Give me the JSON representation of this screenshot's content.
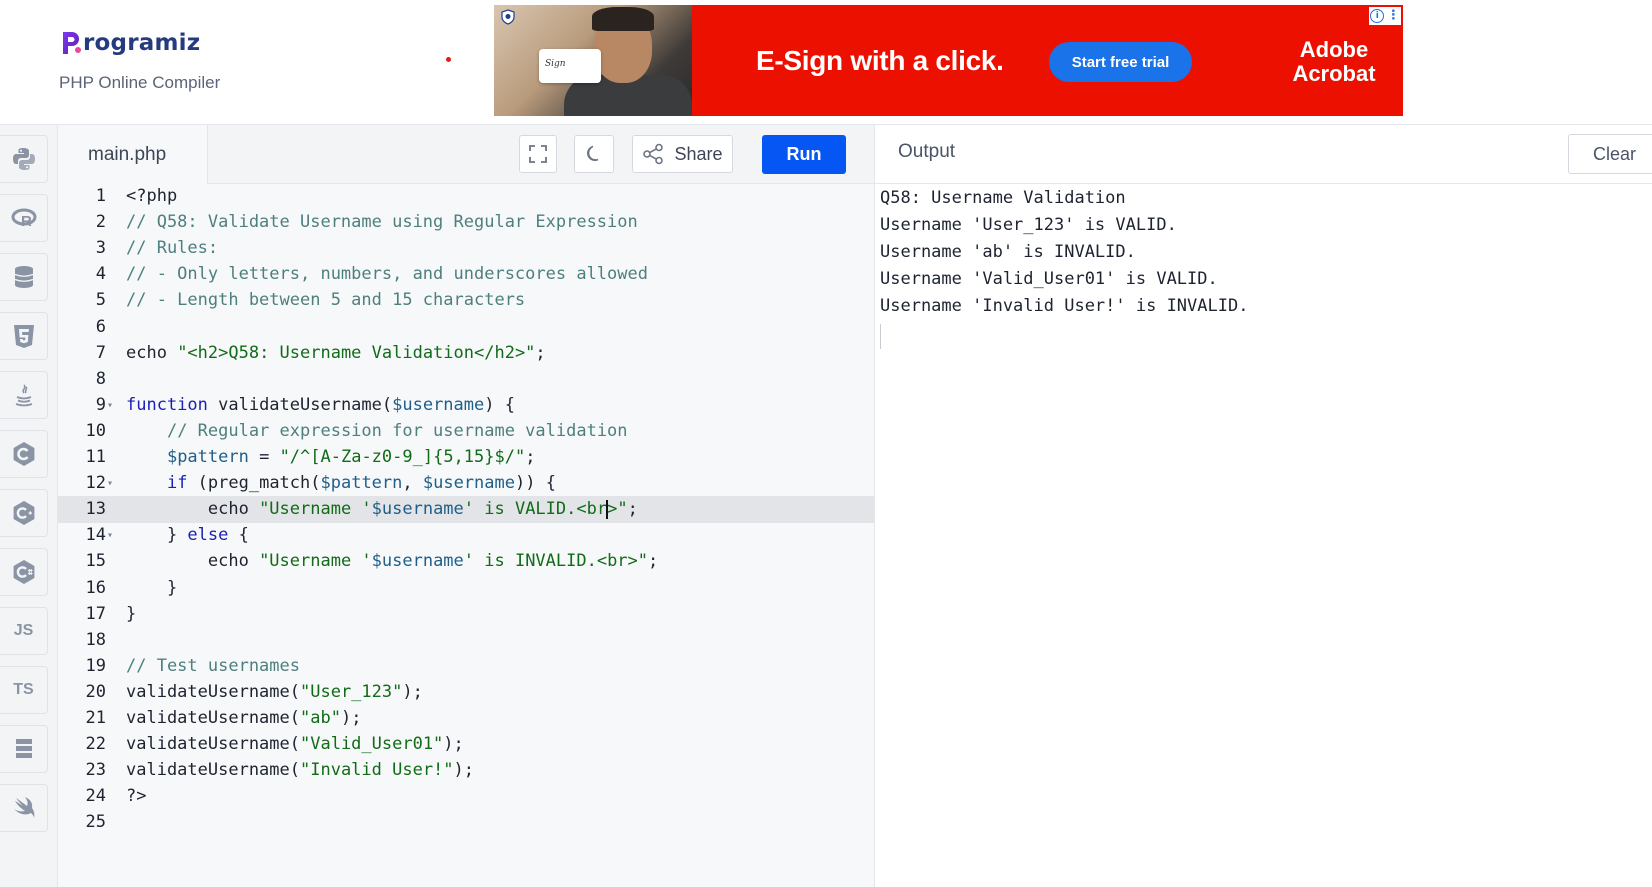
{
  "header": {
    "brand": "rogramiz",
    "subtitle": "PHP Online Compiler"
  },
  "ad": {
    "headline": "E-Sign with a click.",
    "cta": "Start free trial",
    "brand_line1": "Adobe",
    "brand_line2": "Acrobat",
    "card_text": "Sign"
  },
  "rail": {
    "items": [
      {
        "icon": "python-icon"
      },
      {
        "icon": "r-icon"
      },
      {
        "icon": "sql-icon"
      },
      {
        "icon": "html5-icon"
      },
      {
        "icon": "java-icon"
      },
      {
        "icon": "c-icon"
      },
      {
        "icon": "cpp-icon"
      },
      {
        "icon": "csharp-icon"
      },
      {
        "icon": "js-icon",
        "label": "JS"
      },
      {
        "icon": "ts-icon",
        "label": "TS"
      },
      {
        "icon": "go-icon"
      },
      {
        "icon": "swift-icon"
      }
    ]
  },
  "editor": {
    "file_name": "main.php",
    "share_label": "Share",
    "run_label": "Run",
    "active_line": 13,
    "lines": [
      {
        "n": "1",
        "fold": "",
        "tokens": [
          [
            "plain",
            "<?php"
          ]
        ]
      },
      {
        "n": "2",
        "fold": "",
        "tokens": [
          [
            "comment",
            "// Q58: Validate Username using Regular Expression"
          ]
        ]
      },
      {
        "n": "3",
        "fold": "",
        "tokens": [
          [
            "comment",
            "// Rules:"
          ]
        ]
      },
      {
        "n": "4",
        "fold": "",
        "tokens": [
          [
            "comment",
            "// - Only letters, numbers, and underscores allowed"
          ]
        ]
      },
      {
        "n": "5",
        "fold": "",
        "tokens": [
          [
            "comment",
            "// - Length between 5 and 15 characters"
          ]
        ]
      },
      {
        "n": "6",
        "fold": "",
        "tokens": []
      },
      {
        "n": "7",
        "fold": "",
        "tokens": [
          [
            "plain",
            "echo "
          ],
          [
            "string",
            "\"<h2>Q58: Username Validation</h2>\""
          ],
          [
            "plain",
            ";"
          ]
        ]
      },
      {
        "n": "8",
        "fold": "",
        "tokens": []
      },
      {
        "n": "9",
        "fold": "▾",
        "tokens": [
          [
            "kw",
            "function"
          ],
          [
            "plain",
            " validateUsername("
          ],
          [
            "var",
            "$username"
          ],
          [
            "plain",
            ") {"
          ]
        ]
      },
      {
        "n": "10",
        "fold": "",
        "tokens": [
          [
            "plain",
            "    "
          ],
          [
            "comment",
            "// Regular expression for username validation"
          ]
        ]
      },
      {
        "n": "11",
        "fold": "",
        "tokens": [
          [
            "plain",
            "    "
          ],
          [
            "var",
            "$pattern"
          ],
          [
            "plain",
            " = "
          ],
          [
            "string",
            "\"/^[A-Za-z0-9_]{5,15}$/\""
          ],
          [
            "plain",
            ";"
          ]
        ]
      },
      {
        "n": "12",
        "fold": "▾",
        "tokens": [
          [
            "plain",
            "    "
          ],
          [
            "kw",
            "if"
          ],
          [
            "plain",
            " (preg_match("
          ],
          [
            "var",
            "$pattern"
          ],
          [
            "plain",
            ", "
          ],
          [
            "var",
            "$username"
          ],
          [
            "plain",
            ")) {"
          ]
        ]
      },
      {
        "n": "13",
        "fold": "",
        "tokens": [
          [
            "plain",
            "        echo "
          ],
          [
            "string",
            "\"Username '"
          ],
          [
            "var",
            "$username"
          ],
          [
            "string",
            "' is VALID.<br"
          ],
          [
            "cursor",
            ""
          ],
          [
            "string",
            ">\""
          ],
          [
            "plain",
            ";"
          ]
        ]
      },
      {
        "n": "14",
        "fold": "▾",
        "tokens": [
          [
            "plain",
            "    } "
          ],
          [
            "kw",
            "else"
          ],
          [
            "plain",
            " {"
          ]
        ]
      },
      {
        "n": "15",
        "fold": "",
        "tokens": [
          [
            "plain",
            "        echo "
          ],
          [
            "string",
            "\"Username '"
          ],
          [
            "var",
            "$username"
          ],
          [
            "string",
            "' is INVALID.<br>\""
          ],
          [
            "plain",
            ";"
          ]
        ]
      },
      {
        "n": "16",
        "fold": "",
        "tokens": [
          [
            "plain",
            "    }"
          ]
        ]
      },
      {
        "n": "17",
        "fold": "",
        "tokens": [
          [
            "plain",
            "}"
          ]
        ]
      },
      {
        "n": "18",
        "fold": "",
        "tokens": []
      },
      {
        "n": "19",
        "fold": "",
        "tokens": [
          [
            "comment",
            "// Test usernames"
          ]
        ]
      },
      {
        "n": "20",
        "fold": "",
        "tokens": [
          [
            "plain",
            "validateUsername("
          ],
          [
            "string",
            "\"User_123\""
          ],
          [
            "plain",
            ");"
          ]
        ]
      },
      {
        "n": "21",
        "fold": "",
        "tokens": [
          [
            "plain",
            "validateUsername("
          ],
          [
            "string",
            "\"ab\""
          ],
          [
            "plain",
            ");"
          ]
        ]
      },
      {
        "n": "22",
        "fold": "",
        "tokens": [
          [
            "plain",
            "validateUsername("
          ],
          [
            "string",
            "\"Valid_User01\""
          ],
          [
            "plain",
            ");"
          ]
        ]
      },
      {
        "n": "23",
        "fold": "",
        "tokens": [
          [
            "plain",
            "validateUsername("
          ],
          [
            "string",
            "\"Invalid User!\""
          ],
          [
            "plain",
            ");"
          ]
        ]
      },
      {
        "n": "24",
        "fold": "",
        "tokens": [
          [
            "plain",
            "?>"
          ]
        ]
      },
      {
        "n": "25",
        "fold": "",
        "tokens": []
      }
    ]
  },
  "output": {
    "title": "Output",
    "clear_label": "Clear",
    "lines": [
      "Q58: Username Validation",
      "Username 'User_123' is VALID.",
      "Username 'ab' is INVALID.",
      "Username 'Valid_User01' is VALID.",
      "Username 'Invalid User!' is INVALID."
    ]
  },
  "colors": {
    "run_button": "#0556f3",
    "ad_background": "#eb1000",
    "ad_cta": "#1a73e8",
    "brand_text": "#253b80",
    "brand_p": "#7c3aed"
  }
}
